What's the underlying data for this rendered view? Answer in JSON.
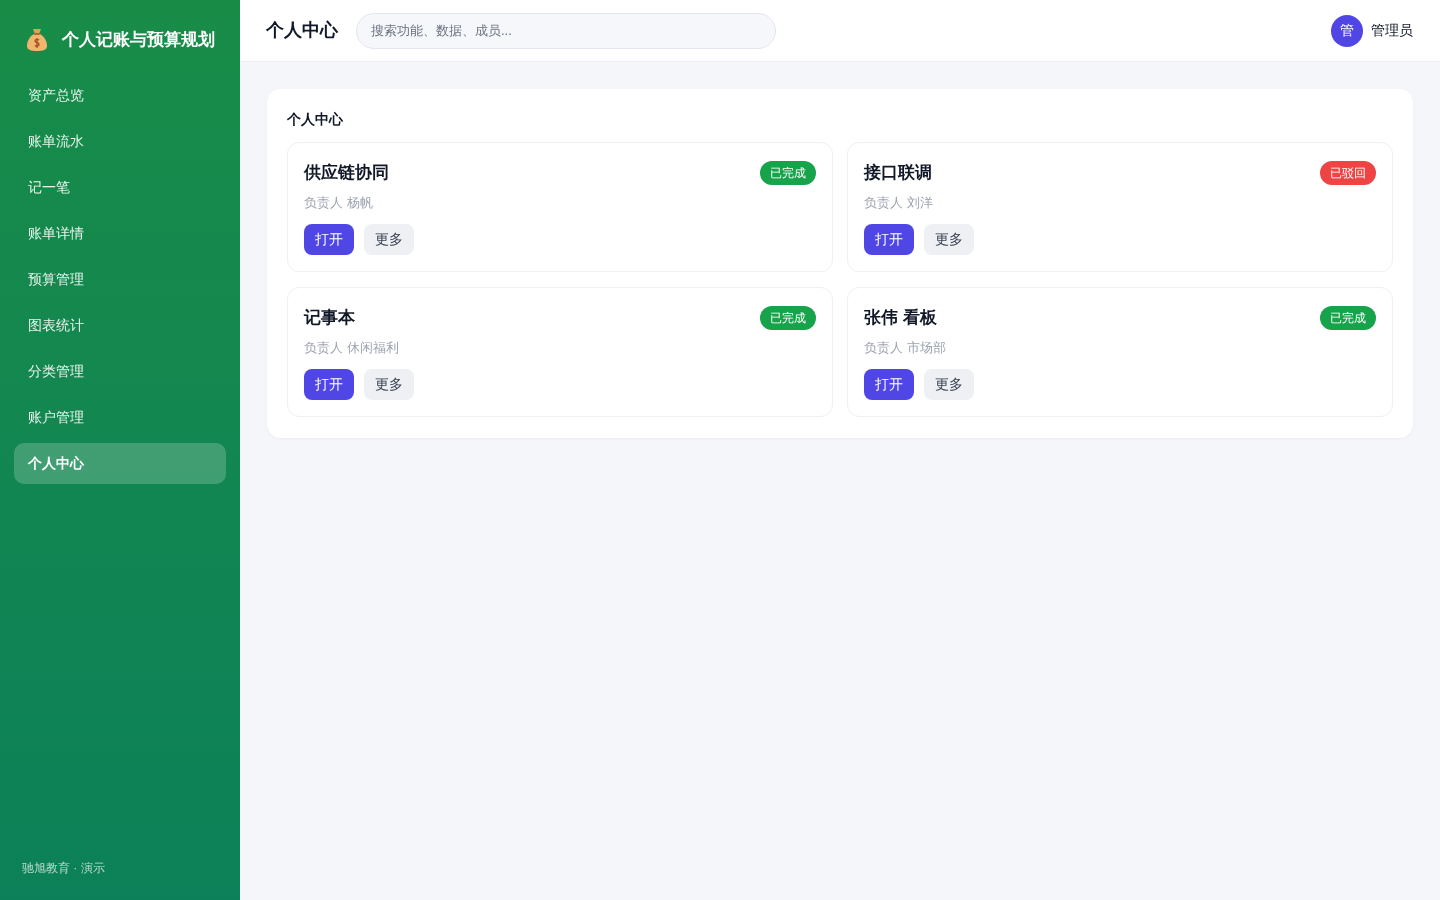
{
  "sidebar": {
    "brand": "个人记账与预算规划",
    "items": [
      {
        "label": "资产总览",
        "selected": false
      },
      {
        "label": "账单流水",
        "selected": false
      },
      {
        "label": "记一笔",
        "selected": false
      },
      {
        "label": "账单详情",
        "selected": false
      },
      {
        "label": "预算管理",
        "selected": false
      },
      {
        "label": "图表统计",
        "selected": false
      },
      {
        "label": "分类管理",
        "selected": false
      },
      {
        "label": "账户管理",
        "selected": false
      },
      {
        "label": "个人中心",
        "selected": true
      }
    ],
    "footer": "驰旭教育 · 演示"
  },
  "header": {
    "title": "个人中心",
    "search": {
      "placeholder": "搜索功能、数据、成员..."
    },
    "user": {
      "avatar": "管",
      "name": "管理员"
    }
  },
  "panel": {
    "title": "个人中心",
    "cards": [
      {
        "title": "供应链协同",
        "status": {
          "label": "已完成",
          "color": "#16a34a"
        },
        "owner": "负责人 杨帆",
        "actions": [
          {
            "label": "打开",
            "kind": "primary"
          },
          {
            "label": "更多",
            "kind": "secondary"
          }
        ]
      },
      {
        "title": "接口联调",
        "status": {
          "label": "已驳回",
          "color": "#ef4444"
        },
        "owner": "负责人 刘洋",
        "actions": [
          {
            "label": "打开",
            "kind": "primary"
          },
          {
            "label": "更多",
            "kind": "secondary"
          }
        ]
      },
      {
        "title": "记事本",
        "status": {
          "label": "已完成",
          "color": "#16a34a"
        },
        "owner": "负责人 休闲福利",
        "actions": [
          {
            "label": "打开",
            "kind": "primary"
          },
          {
            "label": "更多",
            "kind": "secondary"
          }
        ]
      },
      {
        "title": "张伟 看板",
        "status": {
          "label": "已完成",
          "color": "#16a34a"
        },
        "owner": "负责人 市场部",
        "actions": [
          {
            "label": "打开",
            "kind": "primary"
          },
          {
            "label": "更多",
            "kind": "secondary"
          }
        ]
      }
    ]
  }
}
